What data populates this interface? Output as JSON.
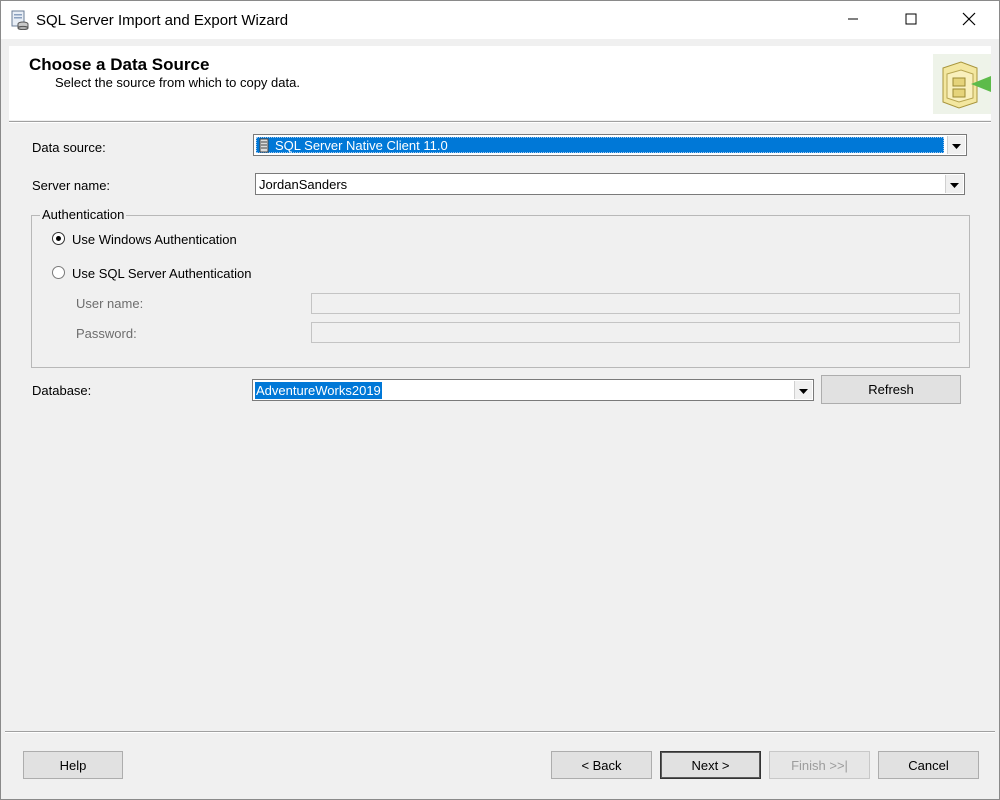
{
  "window": {
    "title": "SQL Server Import and Export Wizard"
  },
  "header": {
    "title": "Choose a Data Source",
    "subtitle": "Select the source from which to copy data."
  },
  "form": {
    "data_source": {
      "label": "Data source:",
      "value": "SQL Server Native Client 11.0"
    },
    "server_name": {
      "label": "Server name:",
      "value": "JordanSanders"
    },
    "authentication": {
      "group_label": "Authentication",
      "windows_auth": "Use Windows Authentication",
      "sql_auth": "Use SQL Server Authentication",
      "selected": "windows",
      "user_name_label": "User name:",
      "password_label": "Password:"
    },
    "database": {
      "label": "Database:",
      "value": "AdventureWorks2019",
      "refresh_label": "Refresh"
    }
  },
  "footer": {
    "help_label": "Help",
    "back_label": "< Back",
    "next_label": "Next >",
    "finish_label": "Finish >>|",
    "cancel_label": "Cancel"
  },
  "colors": {
    "selection": "#0078d7",
    "window_bg": "#f0f0f0"
  }
}
